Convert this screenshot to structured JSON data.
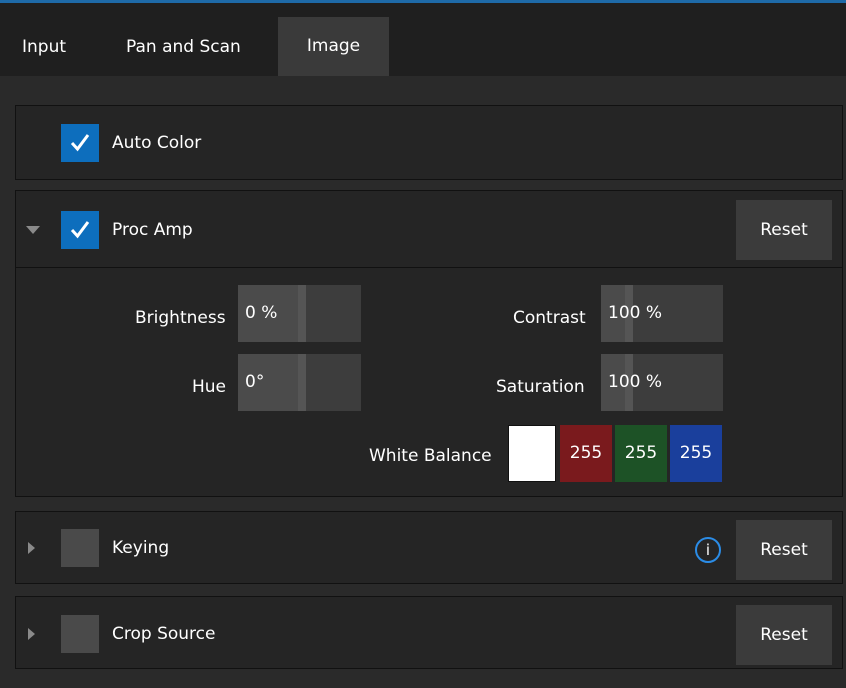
{
  "tabs": [
    {
      "label": "Input",
      "active": false
    },
    {
      "label": "Pan and Scan",
      "active": false
    },
    {
      "label": "Image",
      "active": true
    }
  ],
  "auto_color": {
    "label": "Auto Color",
    "checked": true
  },
  "proc_amp": {
    "label": "Proc Amp",
    "checked": true,
    "expanded": true,
    "reset_label": "Reset",
    "brightness": {
      "label": "Brightness",
      "value": "0 %"
    },
    "contrast": {
      "label": "Contrast",
      "value": "100 %"
    },
    "hue": {
      "label": "Hue",
      "value": "0°"
    },
    "saturation": {
      "label": "Saturation",
      "value": "100 %"
    },
    "white_balance": {
      "label": "White Balance",
      "swatch_color": "#ffffff",
      "red": "255",
      "green": "255",
      "blue": "255"
    }
  },
  "keying": {
    "label": "Keying",
    "checked": false,
    "expanded": false,
    "reset_label": "Reset",
    "info_glyph": "i"
  },
  "crop_source": {
    "label": "Crop Source",
    "checked": false,
    "expanded": false,
    "reset_label": "Reset"
  },
  "colors": {
    "accent": "#0d6ebd",
    "wb_red": "#7a1a1d",
    "wb_green": "#1d5226",
    "wb_blue": "#1a3f9c"
  }
}
